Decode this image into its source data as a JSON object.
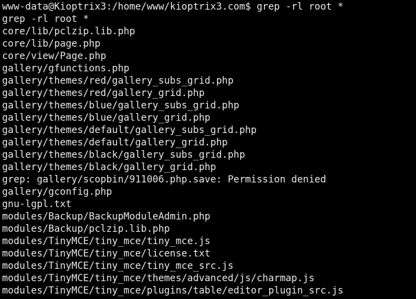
{
  "terminal": {
    "prompt": "www-data@Kioptrix3:/home/www/kioptrix3.com$ ",
    "command": "grep -rl root *",
    "lines": [
      "grep -rl root *",
      "core/lib/pclzip.lib.php",
      "core/lib/page.php",
      "core/view/Page.php",
      "gallery/gfunctions.php",
      "gallery/themes/red/gallery_subs_grid.php",
      "gallery/themes/red/gallery_grid.php",
      "gallery/themes/blue/gallery_subs_grid.php",
      "gallery/themes/blue/gallery_grid.php",
      "gallery/themes/default/gallery_subs_grid.php",
      "gallery/themes/default/gallery_grid.php",
      "gallery/themes/black/gallery_subs_grid.php",
      "gallery/themes/black/gallery_grid.php",
      "grep: gallery/scopbin/911006.php.save: Permission denied",
      "gallery/gconfig.php",
      "gnu-lgpl.txt",
      "modules/Backup/BackupModuleAdmin.php",
      "modules/Backup/pclzip.lib.php",
      "modules/TinyMCE/tiny_mce/tiny_mce.js",
      "modules/TinyMCE/tiny_mce/license.txt",
      "modules/TinyMCE/tiny_mce/tiny_mce_src.js",
      "modules/TinyMCE/tiny_mce/themes/advanced/js/charmap.js",
      "modules/TinyMCE/tiny_mce/plugins/table/editor_plugin_src.js"
    ],
    "colors": {
      "background": "#000000",
      "foreground": "#e8e8e8"
    }
  }
}
